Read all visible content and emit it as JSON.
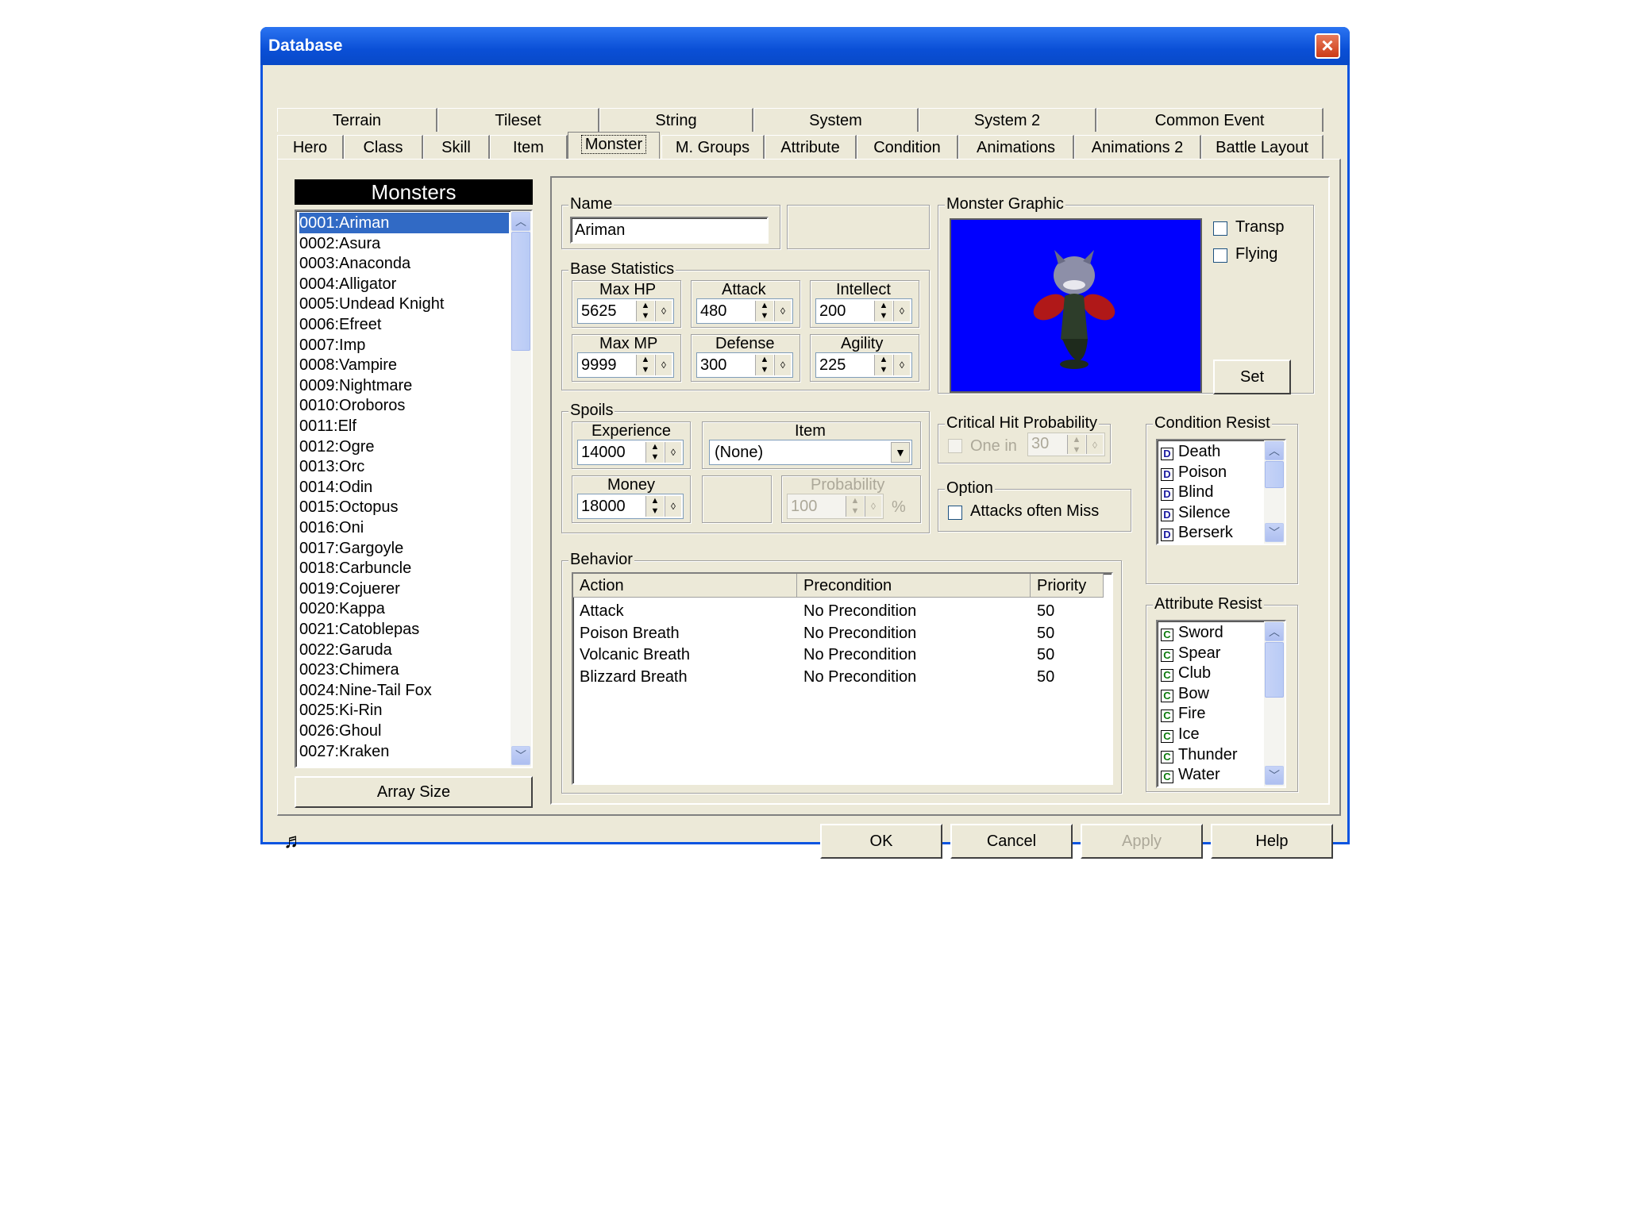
{
  "window": {
    "title": "Database"
  },
  "tabs": {
    "row1": [
      "Terrain",
      "Tileset",
      "String",
      "System",
      "System 2",
      "Common Event"
    ],
    "row2": [
      "Hero",
      "Class",
      "Skill",
      "Item",
      "Monster",
      "M. Groups",
      "Attribute",
      "Condition",
      "Animations",
      "Animations 2",
      "Battle Layout"
    ],
    "selected": "Monster"
  },
  "monsters": {
    "header": "Monsters",
    "items": [
      "0001:Ariman",
      "0002:Asura",
      "0003:Anaconda",
      "0004:Alligator",
      "0005:Undead Knight",
      "0006:Efreet",
      "0007:Imp",
      "0008:Vampire",
      "0009:Nightmare",
      "0010:Oroboros",
      "0011:Elf",
      "0012:Ogre",
      "0013:Orc",
      "0014:Odin",
      "0015:Octopus",
      "0016:Oni",
      "0017:Gargoyle",
      "0018:Carbuncle",
      "0019:Cojuerer",
      "0020:Kappa",
      "0021:Catoblepas",
      "0022:Garuda",
      "0023:Chimera",
      "0024:Nine-Tail Fox",
      "0025:Ki-Rin",
      "0026:Ghoul",
      "0027:Kraken"
    ],
    "selected_index": 0,
    "array_size_label": "Array Size"
  },
  "name": {
    "legend": "Name",
    "value": "Ariman"
  },
  "base_stats": {
    "legend": "Base Statistics",
    "max_hp": {
      "label": "Max HP",
      "value": "5625"
    },
    "attack": {
      "label": "Attack",
      "value": "480"
    },
    "intellect": {
      "label": "Intellect",
      "value": "200"
    },
    "max_mp": {
      "label": "Max MP",
      "value": "9999"
    },
    "defense": {
      "label": "Defense",
      "value": "300"
    },
    "agility": {
      "label": "Agility",
      "value": "225"
    }
  },
  "spoils": {
    "legend": "Spoils",
    "experience": {
      "label": "Experience",
      "value": "14000"
    },
    "item": {
      "label": "Item",
      "value": "(None)"
    },
    "money": {
      "label": "Money",
      "value": "18000"
    },
    "probability": {
      "label": "Probability",
      "value": "100",
      "unit": "%"
    }
  },
  "graphic": {
    "legend": "Monster Graphic",
    "transp_label": "Transp",
    "flying_label": "Flying",
    "set_label": "Set",
    "background": "#0000ff"
  },
  "critical": {
    "legend": "Critical Hit Probability",
    "one_in_label": "One in",
    "value": "30"
  },
  "option": {
    "legend": "Option",
    "miss_label": "Attacks often Miss"
  },
  "condition_resist": {
    "legend": "Condition Resist",
    "items": [
      {
        "tag": "D",
        "label": "Death"
      },
      {
        "tag": "D",
        "label": "Poison"
      },
      {
        "tag": "D",
        "label": "Blind"
      },
      {
        "tag": "D",
        "label": "Silence"
      },
      {
        "tag": "D",
        "label": "Berserk"
      }
    ]
  },
  "attribute_resist": {
    "legend": "Attribute Resist",
    "items": [
      {
        "tag": "C",
        "label": "Sword"
      },
      {
        "tag": "C",
        "label": "Spear"
      },
      {
        "tag": "C",
        "label": "Club"
      },
      {
        "tag": "C",
        "label": "Bow"
      },
      {
        "tag": "C",
        "label": "Fire"
      },
      {
        "tag": "C",
        "label": "Ice"
      },
      {
        "tag": "C",
        "label": "Thunder"
      },
      {
        "tag": "C",
        "label": "Water"
      }
    ]
  },
  "behavior": {
    "legend": "Behavior",
    "columns": [
      "Action",
      "Precondition",
      "Priority"
    ],
    "rows": [
      {
        "action": "Attack",
        "precondition": "No Precondition",
        "priority": "50"
      },
      {
        "action": "Poison Breath",
        "precondition": "No Precondition",
        "priority": "50"
      },
      {
        "action": "Volcanic Breath",
        "precondition": "No Precondition",
        "priority": "50"
      },
      {
        "action": "Blizzard Breath",
        "precondition": "No Precondition",
        "priority": "50"
      }
    ]
  },
  "footer": {
    "ok": "OK",
    "cancel": "Cancel",
    "apply": "Apply",
    "help": "Help",
    "music_icon": "music-note-icon"
  }
}
